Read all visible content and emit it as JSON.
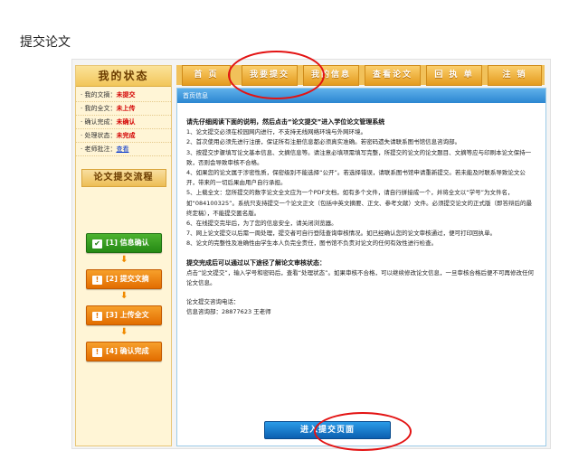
{
  "page_title": "提交论文",
  "sidebar": {
    "heading": "我的状态",
    "status": [
      {
        "label": "· 我的文摘：",
        "value": "未提交"
      },
      {
        "label": "· 我的全文：",
        "value": "未上传"
      },
      {
        "label": "· 确认完成：",
        "value": "未确认"
      },
      {
        "label": "· 处理状态：",
        "value": "未完成"
      },
      {
        "label": "· 老师批注：",
        "value": "查看"
      }
    ],
    "flow_heading": "论文提交流程",
    "steps": [
      {
        "icon": "✔",
        "label": "[1] 信息确认"
      },
      {
        "icon": "!",
        "label": "[2] 提交文摘"
      },
      {
        "icon": "!",
        "label": "[3] 上传全文"
      },
      {
        "icon": "!",
        "label": "[4] 确认完成"
      }
    ]
  },
  "nav": {
    "tabs": [
      "首 页",
      "我要提交",
      "我的信息",
      "查看论文",
      "回 执 单",
      "注 销"
    ]
  },
  "main": {
    "header": "首页信息",
    "intro_heading": "请先仔细阅读下面的说明，然后点击“论文提交”进入学位论文管理系统",
    "items": [
      "1、论文提交必须在校园网内进行，不支持无线网络环境与外网环境。",
      "2、首次使用必须先进行注册，保证所有注册信息都必须真实准确。若密码遗失请联系图书馆信息咨询部。",
      "3、按提交步骤填写论文基本信息、文摘信息等。请注意必填项需填写完整，所提交的论文的论文题目、文摘等应与印刷本论文保持一致，否则会导致审核不合格。",
      "4、如果您的论文属于涉密性质，保密级别不能选择“公开”。若选择错误，请联系图书馆申请重新提交。若未能及时联系导致论文公开，带来的一切后果由用户自行承担。",
      "5、上载全文：您所提交的数字论文全文应为一个PDF文档，如有多个文件，请自行拼接成一个，并将全文以“学号”为文件名，如“084100325”。系统只支持提交一个论文正文（包括中英文摘要、正文、参考文献）文件。必须提交论文的正式版（即答辩后的最终定稿），不能提交匿名版。",
      "6、在线提交完毕后，为了您的信息安全，请关闭浏览器。",
      "7、网上论文提交以后需一周处理，提交者可自行登陆查询审核情况。如已经确认您的论文审核通过，便可打印回执单。",
      "8、论文的完整性及准确性由学生本人负完全责任，图书馆不负责对论文的任何有效性进行检查。"
    ],
    "status_heading": "提交完成后可以通过以下途径了解论文审核状态：",
    "status_text": "点击“论文提交”，输入学号和密码后，查看“处理状态”。如果审核不合格，可以继续修改论文信息，一旦审核合格后便不可再修改任何论文信息。",
    "contact_heading": "论文提交咨询电话：",
    "contact": "信息咨询部：28877623 王老师",
    "enter_button": "进入提交页面"
  },
  "colors": {
    "annotation": "#e31313",
    "accent_orange": "#e26d00",
    "accent_blue": "#2b86d1"
  }
}
